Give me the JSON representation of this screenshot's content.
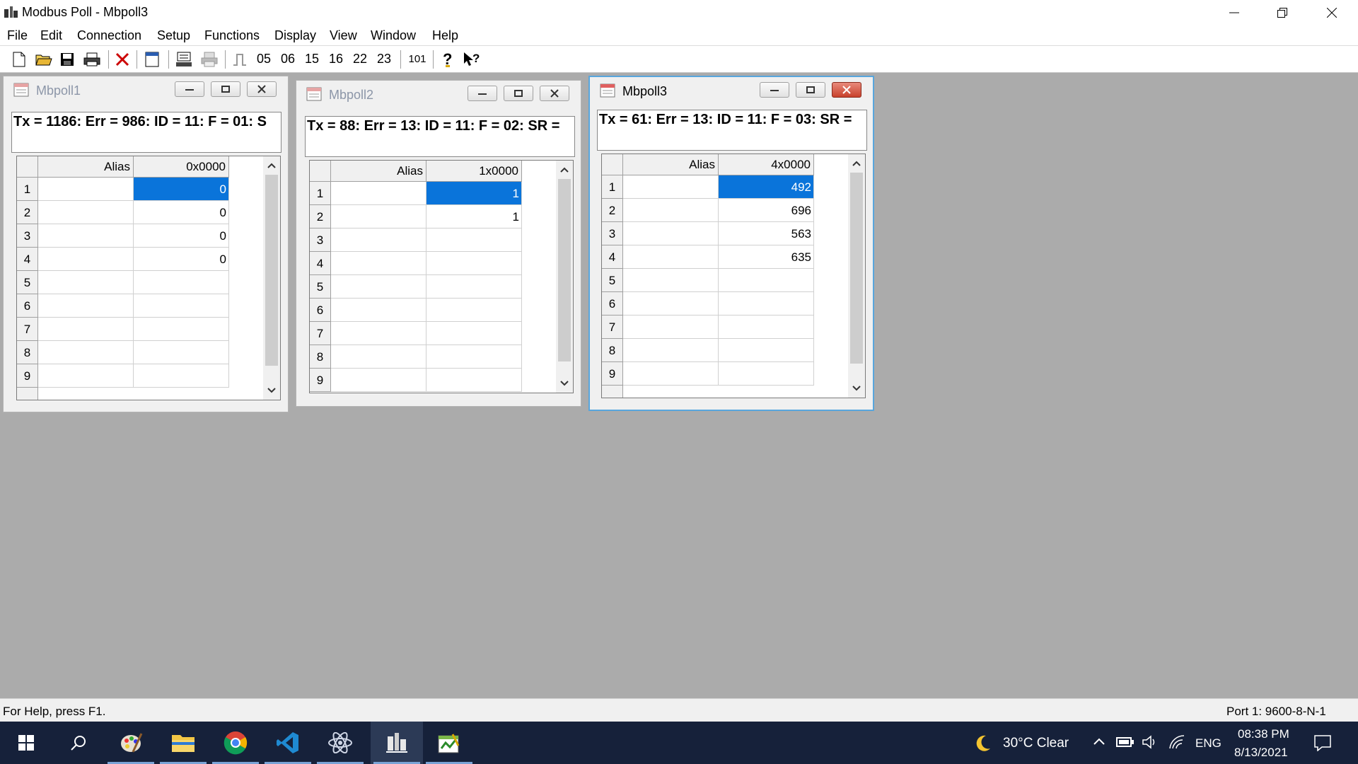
{
  "window": {
    "title": "Modbus Poll - Mbpoll3"
  },
  "menu": [
    "File",
    "Edit",
    "Connection",
    "Setup",
    "Functions",
    "Display",
    "View",
    "Window",
    "Help"
  ],
  "toolbar": {
    "function_codes": [
      "05",
      "06",
      "15",
      "16",
      "22",
      "23"
    ],
    "comm_label": "101"
  },
  "children": [
    {
      "name": "Mbpoll1",
      "status": "Tx = 1186: Err = 986: ID = 11: F = 01: S",
      "alias_header": "Alias",
      "address_header": "0x0000",
      "rows": [
        "1",
        "2",
        "3",
        "4",
        "5",
        "6",
        "7",
        "8",
        "9"
      ],
      "values": [
        "0",
        "0",
        "0",
        "0",
        "",
        "",
        "",
        "",
        ""
      ],
      "active": false
    },
    {
      "name": "Mbpoll2",
      "status": "Tx = 88: Err = 13: ID = 11: F = 02: SR =",
      "alias_header": "Alias",
      "address_header": "1x0000",
      "rows": [
        "1",
        "2",
        "3",
        "4",
        "5",
        "6",
        "7",
        "8",
        "9"
      ],
      "values": [
        "1",
        "1",
        "",
        "",
        "",
        "",
        "",
        "",
        ""
      ],
      "active": false
    },
    {
      "name": "Mbpoll3",
      "status": "Tx = 61: Err = 13: ID = 11: F = 03: SR =",
      "alias_header": "Alias",
      "address_header": "4x0000",
      "rows": [
        "1",
        "2",
        "3",
        "4",
        "5",
        "6",
        "7",
        "8",
        "9"
      ],
      "values": [
        "492",
        "696",
        "563",
        "635",
        "",
        "",
        "",
        "",
        ""
      ],
      "active": true
    }
  ],
  "statusbar": {
    "help": "For Help, press F1.",
    "port": "Port 1: 9600-8-N-1"
  },
  "taskbar": {
    "apps": [
      "start-icon",
      "search-icon",
      "paint-icon",
      "file-explorer-icon",
      "chrome-icon",
      "vscode-icon",
      "atom-icon",
      "modbus-poll-icon",
      "modbus-slave-icon"
    ],
    "weather": "30°C  Clear",
    "language": "ENG",
    "time": "08:38 PM",
    "date": "8/13/2021"
  },
  "colors": {
    "selection": "#0a74da",
    "mdi_background": "#ababab",
    "active_border": "#58a6dd",
    "taskbar": "#16213a"
  }
}
